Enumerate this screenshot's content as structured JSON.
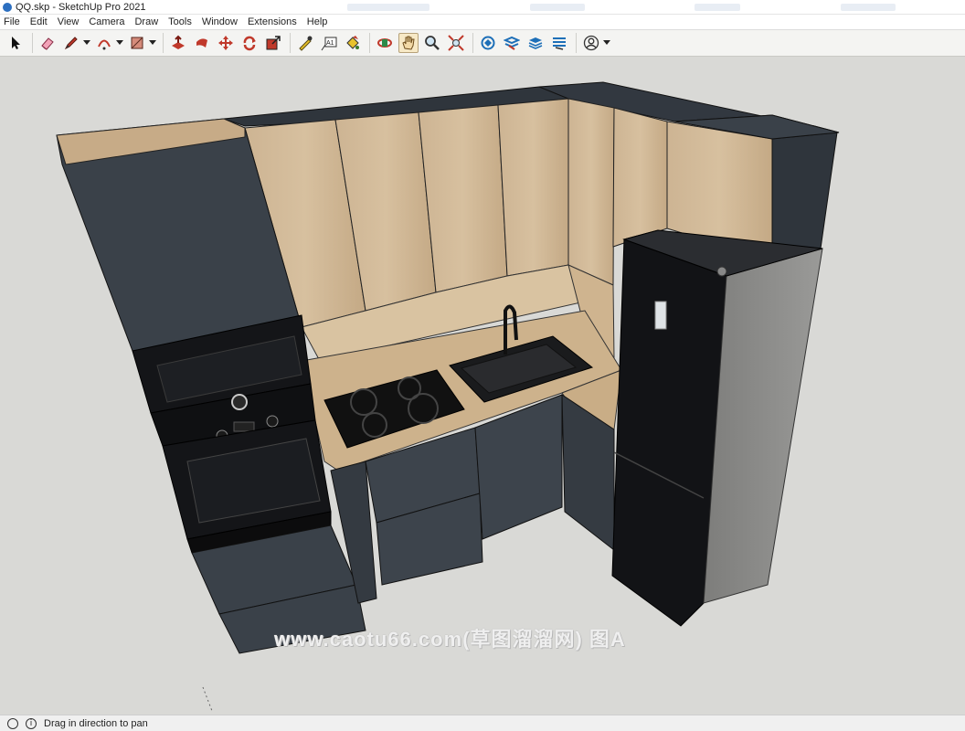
{
  "window": {
    "title": "QQ.skp - SketchUp Pro 2021"
  },
  "menu": [
    "File",
    "Edit",
    "View",
    "Camera",
    "Draw",
    "Tools",
    "Window",
    "Extensions",
    "Help"
  ],
  "toolbar": {
    "tools": [
      {
        "name": "select-tool",
        "icon": "arrow-cursor-icon"
      },
      {
        "name": "eraser-tool",
        "icon": "eraser-icon"
      },
      {
        "name": "pencil-tool",
        "icon": "pencil-icon"
      },
      {
        "name": "arc-tool",
        "icon": "arc-icon"
      },
      {
        "name": "rectangle-tool",
        "icon": "rectangle-icon"
      },
      {
        "name": "push-pull-tool",
        "icon": "push-pull-icon"
      },
      {
        "name": "follow-me-tool",
        "icon": "follow-me-icon"
      },
      {
        "name": "move-tool",
        "icon": "move-icon"
      },
      {
        "name": "rotate-tool",
        "icon": "rotate-icon"
      },
      {
        "name": "scale-tool",
        "icon": "scale-icon"
      },
      {
        "name": "tape-measure-tool",
        "icon": "tape-measure-icon"
      },
      {
        "name": "text-tool",
        "icon": "text-icon"
      },
      {
        "name": "paint-bucket-tool",
        "icon": "paint-bucket-icon"
      },
      {
        "name": "orbit-tool",
        "icon": "orbit-icon"
      },
      {
        "name": "pan-tool",
        "icon": "hand-icon",
        "active": true
      },
      {
        "name": "zoom-tool",
        "icon": "magnifier-icon"
      },
      {
        "name": "zoom-extents-tool",
        "icon": "zoom-extents-icon"
      },
      {
        "name": "warehouse-tool",
        "icon": "warehouse-icon"
      },
      {
        "name": "extension-warehouse-tool",
        "icon": "extension-warehouse-icon"
      },
      {
        "name": "layout-tool",
        "icon": "layout-icon"
      },
      {
        "name": "send-to-layout-tool",
        "icon": "send-to-layout-icon"
      },
      {
        "name": "account-menu",
        "icon": "user-icon"
      }
    ],
    "text_tool_glyph": "A1"
  },
  "watermark": "www.caotu66.com(草图溜溜网) 图A",
  "status": {
    "message": "Drag in direction to pan",
    "icon_glyph": "i"
  },
  "colors": {
    "cabinet_dark": "#3d444c",
    "wood": "#c8ae8c",
    "background": "#d9d9d6",
    "fridge_black": "#121316",
    "fridge_side": "#8a8a88"
  }
}
